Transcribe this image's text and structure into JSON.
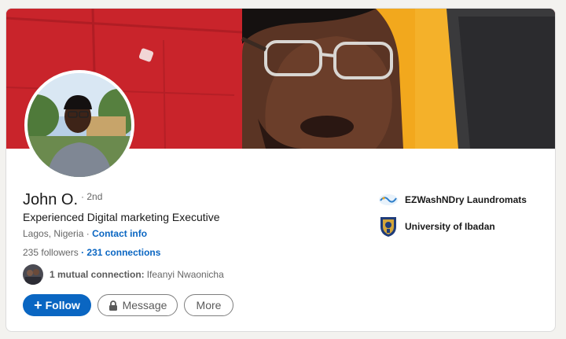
{
  "profile": {
    "name": "John O.",
    "degree": "· 2nd",
    "headline": "Experienced Digital marketing Executive",
    "location": "Lagos, Nigeria",
    "separator": "·",
    "contact_info": "Contact info",
    "followers": "235 followers",
    "connections": "· 231 connections",
    "mutual_label": "1 mutual connection:",
    "mutual_name": "Ifeanyi Nwaonicha"
  },
  "actions": {
    "follow": "Follow",
    "message": "Message",
    "more": "More"
  },
  "experience": [
    {
      "name": "EZWashNDry Laundromats",
      "logo": "ezwash-logo-icon"
    },
    {
      "name": "University of Ibadan",
      "logo": "university-crest-icon"
    }
  ],
  "colors": {
    "brand_blue": "#0a66c2",
    "banner_red": "#c8232c",
    "banner_orange": "#f2a81d"
  }
}
